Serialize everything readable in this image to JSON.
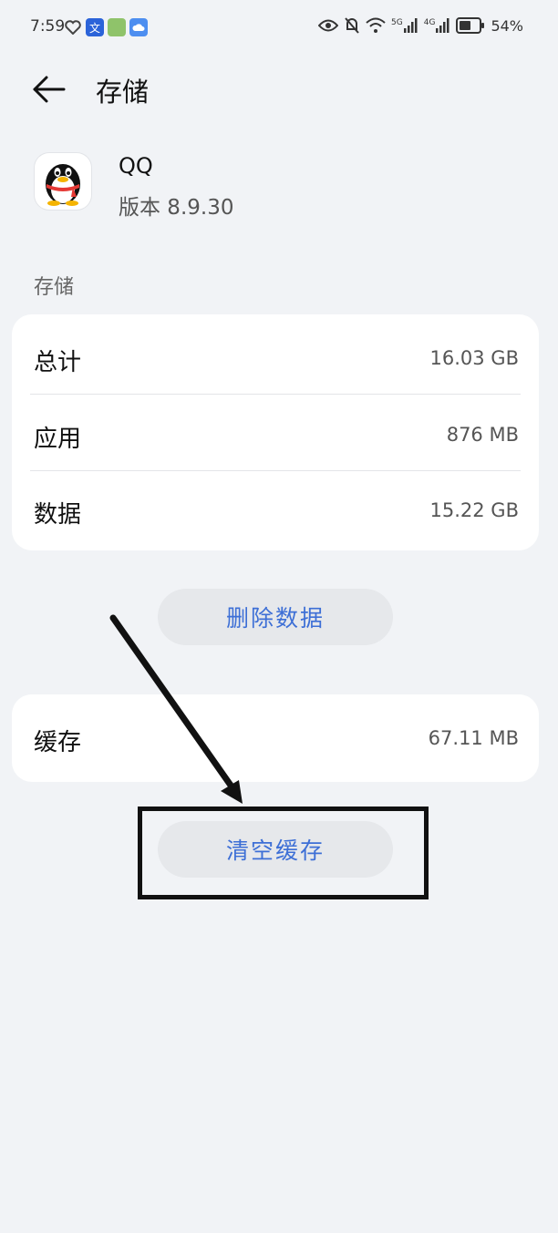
{
  "status_bar": {
    "time": "7:59",
    "battery_percent": "54%",
    "network_5g": "5G",
    "network_4g": "4G",
    "notif_wen": "文"
  },
  "header": {
    "title": "存储"
  },
  "app": {
    "name": "QQ",
    "version": "版本 8.9.30"
  },
  "storage_section": {
    "label": "存储",
    "rows": [
      {
        "label": "总计",
        "value": "16.03 GB"
      },
      {
        "label": "应用",
        "value": "876 MB"
      },
      {
        "label": "数据",
        "value": "15.22 GB"
      }
    ]
  },
  "buttons": {
    "delete_data": "删除数据",
    "clear_cache": "清空缓存"
  },
  "cache_row": {
    "label": "缓存",
    "value": "67.11 MB"
  },
  "colors": {
    "background": "#f1f3f6",
    "accent": "#3d6fd6"
  }
}
